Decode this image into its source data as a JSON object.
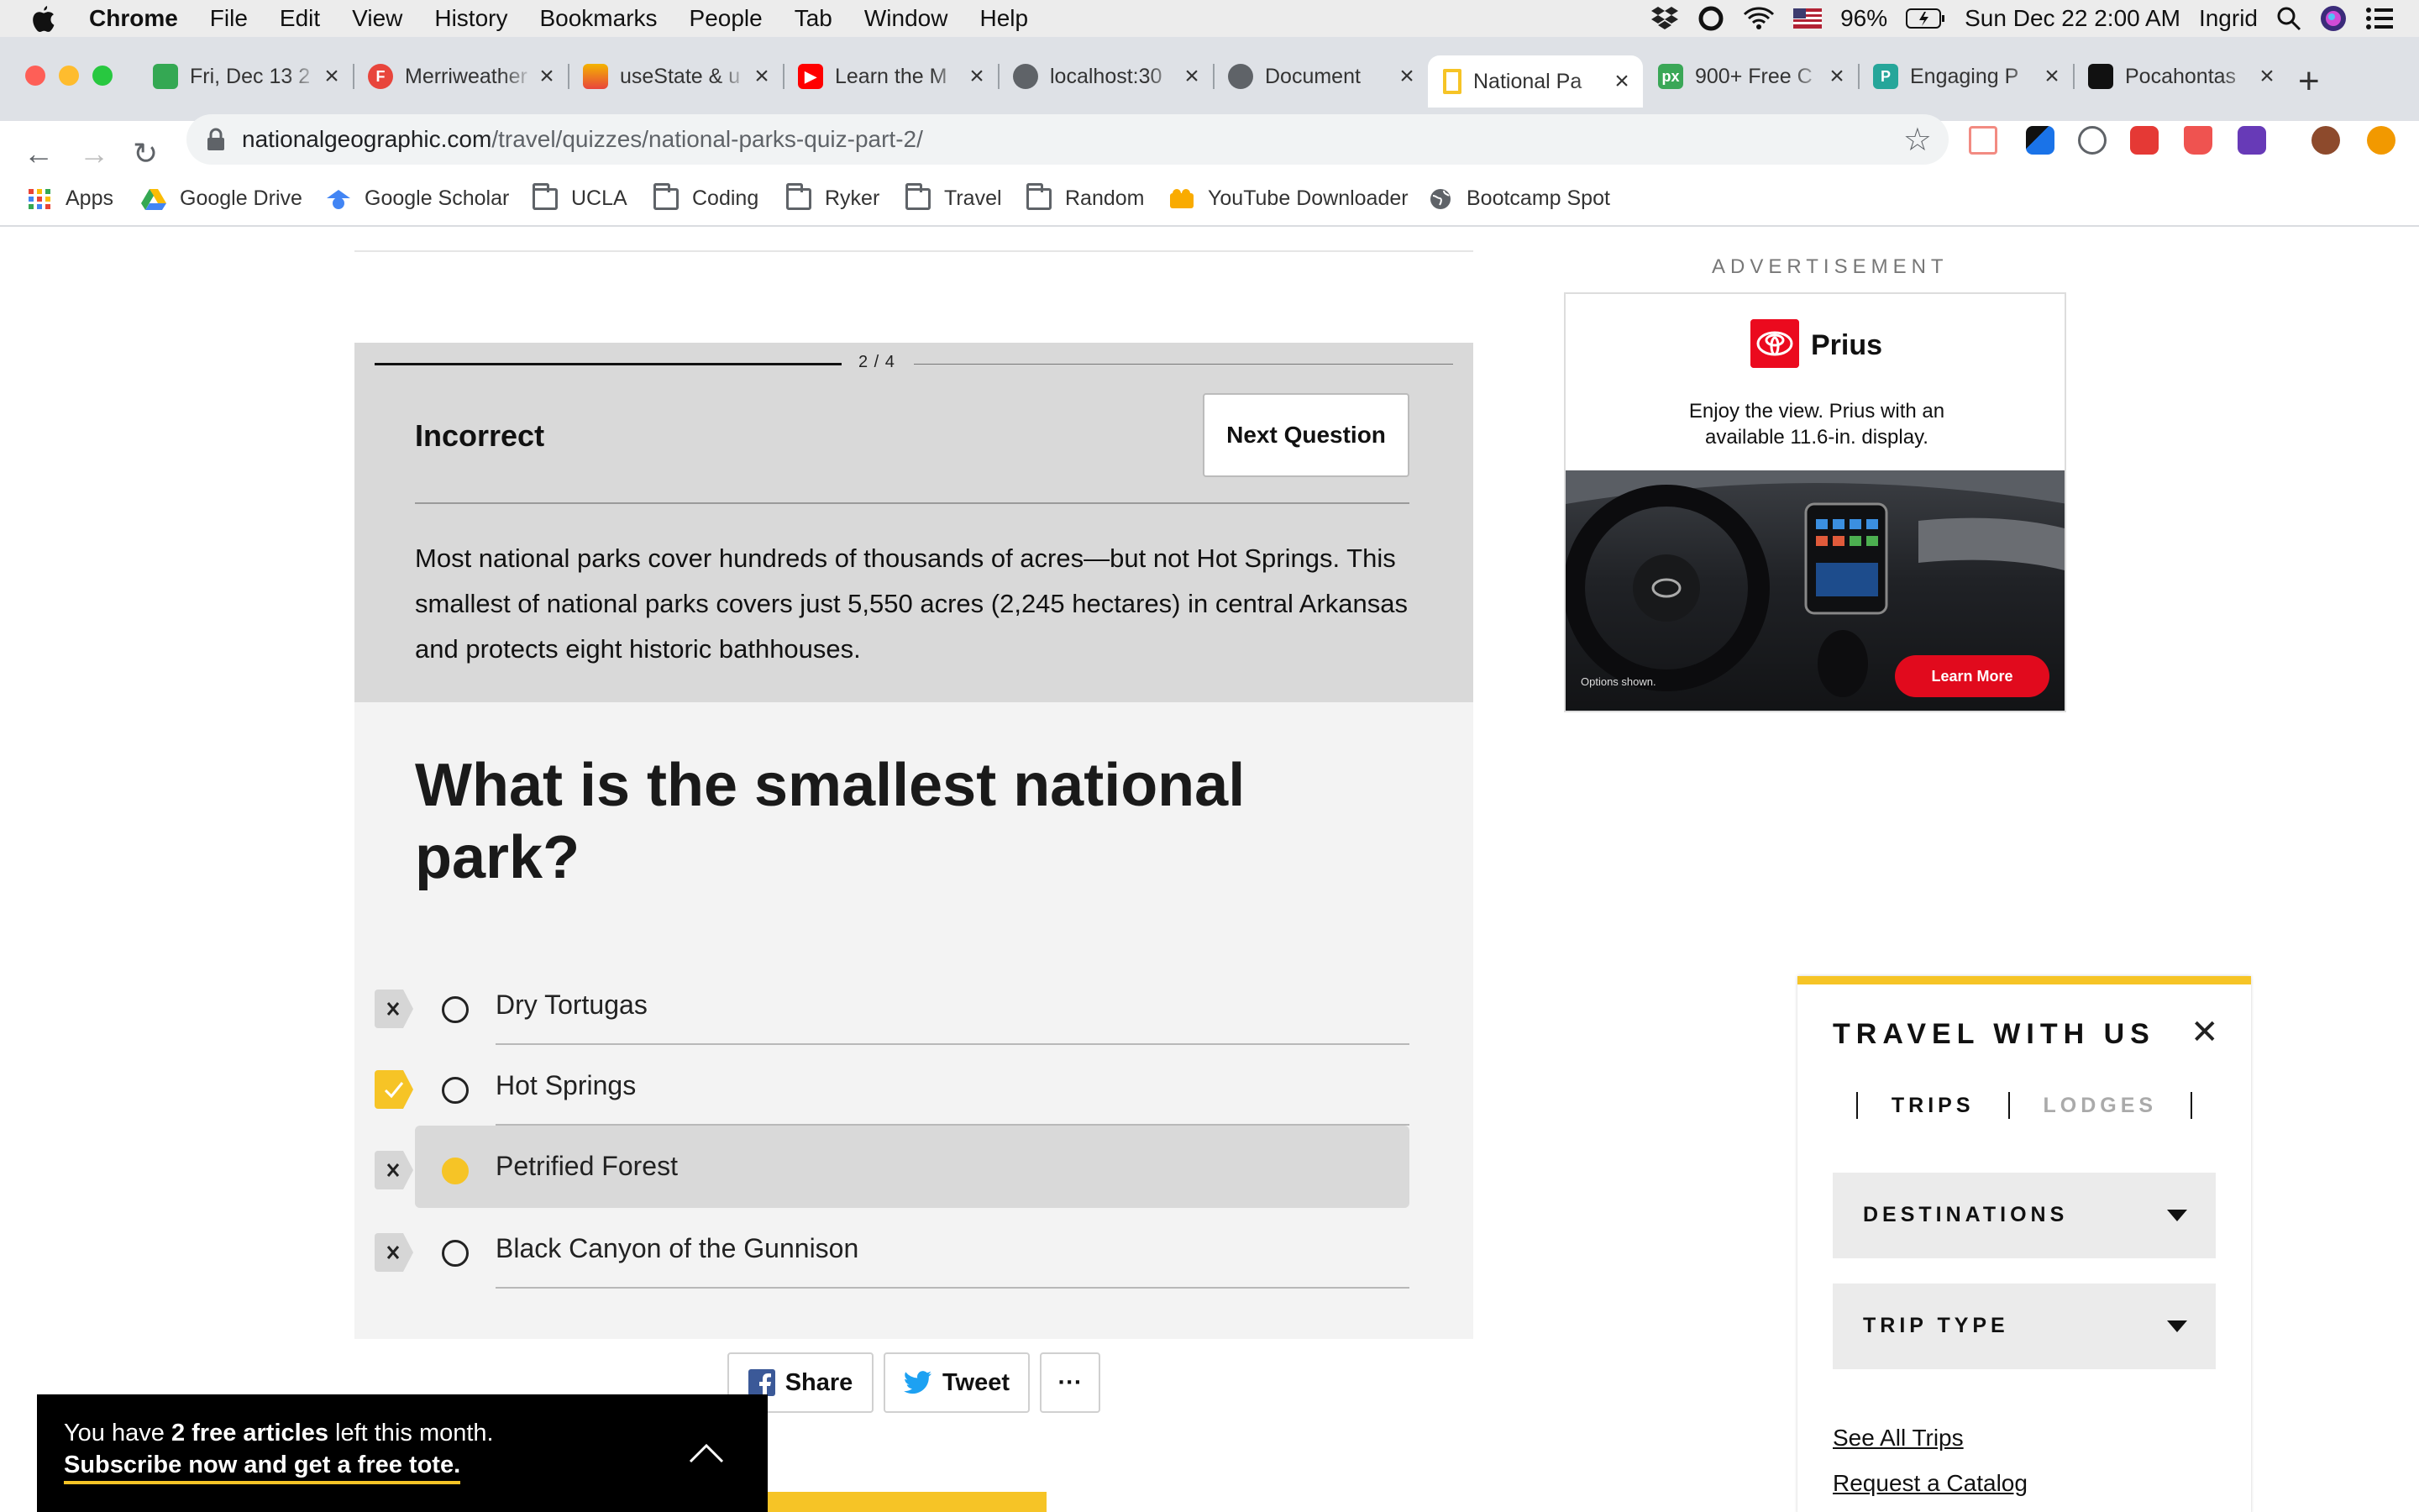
{
  "menubar": {
    "app": "Chrome",
    "items": [
      "File",
      "Edit",
      "View",
      "History",
      "Bookmarks",
      "People",
      "Tab",
      "Window",
      "Help"
    ],
    "battery": "96%",
    "datetime": "Sun Dec 22  2:00 AM",
    "user": "Ingrid"
  },
  "tabs": [
    {
      "title": "Fri, Dec 13 2",
      "color": "#34a853"
    },
    {
      "title": "Merriweather",
      "color": "#e8453c"
    },
    {
      "title": "useState & u",
      "color": "#f4b400"
    },
    {
      "title": "Learn the M",
      "color": "#ff0000"
    },
    {
      "title": "localhost:30",
      "color": "#5f6368"
    },
    {
      "title": "Document",
      "color": "#5f6368"
    },
    {
      "title": "National Pa",
      "color": "#f6c426"
    },
    {
      "title": "900+ Free C",
      "color": "#3aa757"
    },
    {
      "title": "Engaging P",
      "color": "#26a69a"
    },
    {
      "title": "Pocahontas",
      "color": "#111111"
    }
  ],
  "address": {
    "domain": "nationalgeographic.com",
    "path": "/travel/quizzes/national-parks-quiz-part-2/"
  },
  "bookmarks": [
    {
      "label": "Apps",
      "icon": "apps-grid-icon"
    },
    {
      "label": "Google Drive",
      "icon": "google-drive-icon"
    },
    {
      "label": "Google Scholar",
      "icon": "google-scholar-icon"
    },
    {
      "label": "UCLA",
      "icon": "folder-icon"
    },
    {
      "label": "Coding",
      "icon": "folder-icon"
    },
    {
      "label": "Ryker",
      "icon": "folder-icon"
    },
    {
      "label": "Travel",
      "icon": "folder-icon"
    },
    {
      "label": "Random",
      "icon": "folder-icon"
    },
    {
      "label": "YouTube Downloader",
      "icon": "youtube-downloader-icon"
    },
    {
      "label": "Bootcamp Spot",
      "icon": "globe-icon"
    }
  ],
  "quiz": {
    "progress": "2 / 4",
    "result": "Incorrect",
    "next_label": "Next Question",
    "explanation": "Most national parks cover hundreds of thousands of acres—but not Hot Springs. This smallest of national parks covers just 5,550 acres (2,245 hectares) in central Arkansas and protects eight historic bathhouses.",
    "question": "What is the smallest national park?",
    "answers": [
      {
        "label": "Dry Tortugas",
        "status": "wrong"
      },
      {
        "label": "Hot Springs",
        "status": "correct"
      },
      {
        "label": "Petrified Forest",
        "status": "wrong-selected"
      },
      {
        "label": "Black Canyon of the Gunnison",
        "status": "wrong"
      }
    ]
  },
  "share": {
    "share_label": "Share",
    "tweet_label": "Tweet",
    "more_label": "···"
  },
  "ad": {
    "label": "ADVERTISEMENT",
    "brand": "Prius",
    "tagline": "Enjoy the view. Prius with an available 11.6-in. display.",
    "fineprint": "Options shown.",
    "cta": "Learn More"
  },
  "travel": {
    "title": "TRAVEL WITH US",
    "tab_active": "TRIPS",
    "tab_inactive": "LODGES",
    "dropdown1": "DESTINATIONS",
    "dropdown2": "TRIP TYPE",
    "link1": "See All Trips",
    "link2": "Request a Catalog"
  },
  "paywall": {
    "prefix": "You have ",
    "count": "2 free articles",
    "suffix": " left this month.",
    "cta": "Subscribe now and get a free tote."
  },
  "colors": {
    "accent": "#f6c426",
    "toyota_red": "#eb0a1e"
  }
}
